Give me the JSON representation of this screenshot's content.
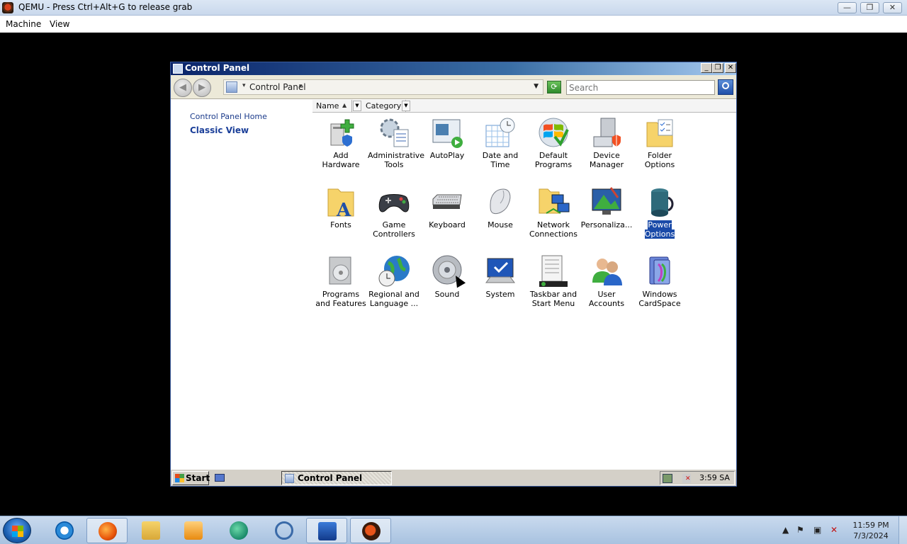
{
  "qemu": {
    "title": "QEMU - Press Ctrl+Alt+G to release grab",
    "menu": [
      "Machine",
      "View"
    ]
  },
  "window": {
    "title": "Control Panel",
    "address": "Control Panel",
    "search_placeholder": "Search",
    "side_links": {
      "home": "Control Panel Home",
      "classic": "Classic View"
    },
    "columns": [
      "Name",
      "Category"
    ]
  },
  "icons": [
    {
      "label": "Add Hardware",
      "icon": "add-hardware-icon"
    },
    {
      "label": "Administrative Tools",
      "icon": "administrative-tools-icon"
    },
    {
      "label": "AutoPlay",
      "icon": "autoplay-icon"
    },
    {
      "label": "Date and Time",
      "icon": "date-time-icon"
    },
    {
      "label": "Default Programs",
      "icon": "default-programs-icon"
    },
    {
      "label": "Device Manager",
      "icon": "device-manager-icon"
    },
    {
      "label": "Folder Options",
      "icon": "folder-options-icon"
    },
    {
      "label": "Fonts",
      "icon": "fonts-icon"
    },
    {
      "label": "Game Controllers",
      "icon": "game-controllers-icon"
    },
    {
      "label": "Keyboard",
      "icon": "keyboard-icon"
    },
    {
      "label": "Mouse",
      "icon": "mouse-icon"
    },
    {
      "label": "Network Connections",
      "icon": "network-connections-icon"
    },
    {
      "label": "Personaliza...",
      "icon": "personalization-icon"
    },
    {
      "label": "Power Options",
      "icon": "power-options-icon",
      "selected": true
    },
    {
      "label": "Programs and Features",
      "icon": "programs-features-icon"
    },
    {
      "label": "Regional and Language ...",
      "icon": "regional-language-icon"
    },
    {
      "label": "Sound",
      "icon": "sound-icon"
    },
    {
      "label": "System",
      "icon": "system-icon"
    },
    {
      "label": "Taskbar and Start Menu",
      "icon": "taskbar-start-menu-icon"
    },
    {
      "label": "User Accounts",
      "icon": "user-accounts-icon"
    },
    {
      "label": "Windows CardSpace",
      "icon": "windows-cardspace-icon"
    }
  ],
  "guest_taskbar": {
    "start": "Start",
    "task": "Control Panel",
    "clock": "3:59 SA"
  },
  "host_taskbar": {
    "time": "11:59 PM",
    "date": "7/3/2024",
    "pins": [
      "internet-explorer-icon",
      "firefox-icon",
      "file-explorer-icon",
      "media-player-icon",
      "app-globe-icon",
      "snipping-tool-icon",
      "powershell-icon",
      "qemu-icon"
    ]
  }
}
